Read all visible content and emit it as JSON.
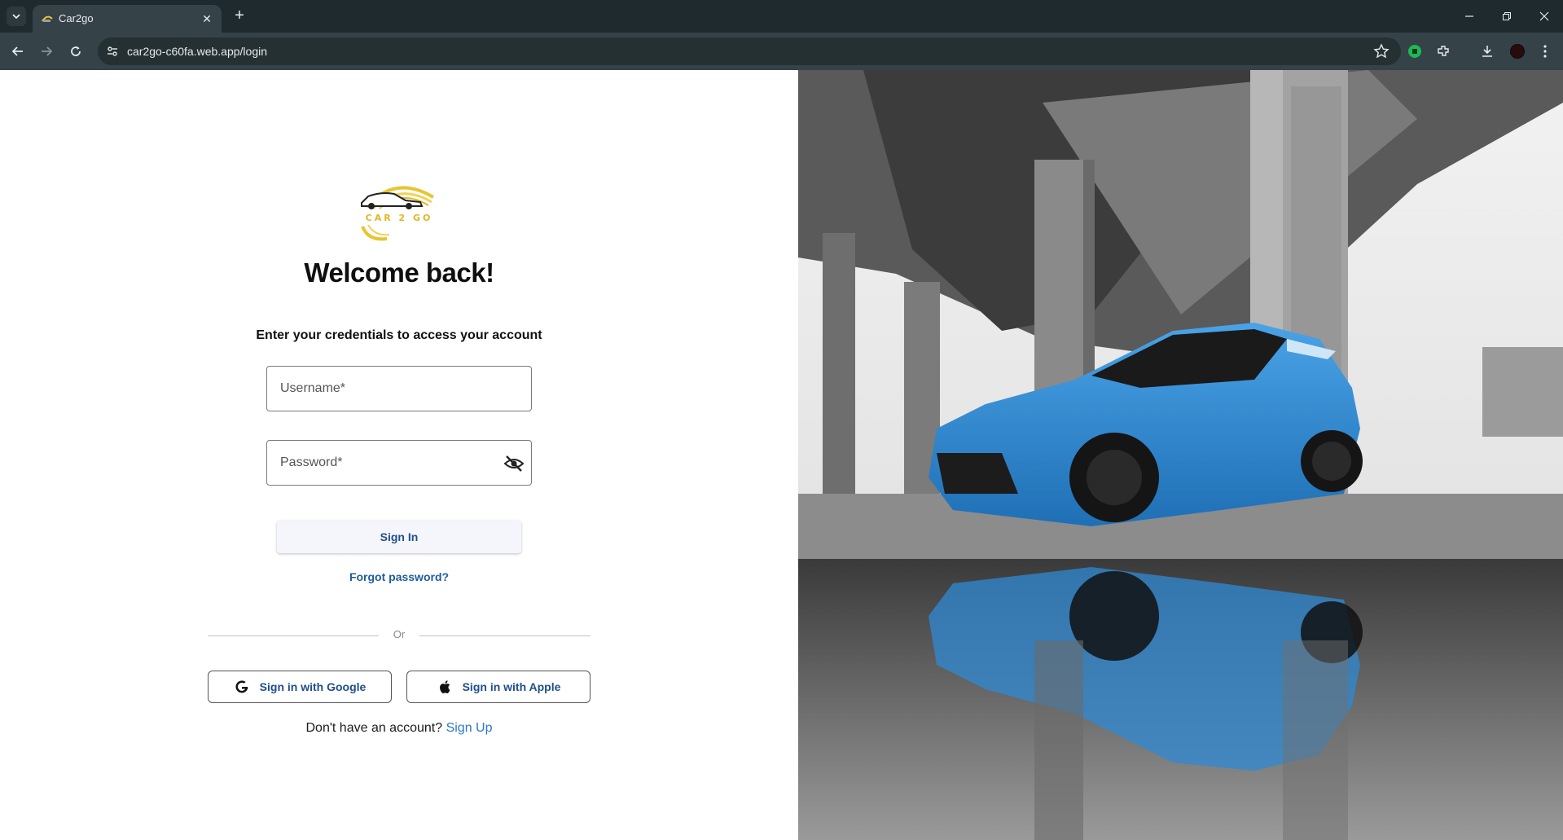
{
  "browser": {
    "tab_title": "Car2go",
    "url": "car2go-c60fa.web.app/login"
  },
  "logo": {
    "text": "CAR 2 GO",
    "accent": "#e8c431"
  },
  "login": {
    "heading": "Welcome back!",
    "subheading": "Enter your credentials to access your account",
    "username_placeholder": "Username*",
    "password_placeholder": "Password*",
    "signin_label": "Sign In",
    "forgot_label": "Forgot password?",
    "or_label": "Or",
    "google_label": "Sign in with Google",
    "apple_label": "Sign in with Apple",
    "signup_prompt": "Don't have an account?",
    "signup_link": "Sign Up"
  },
  "colors": {
    "link": "#2d78c9",
    "button_text": "#1f4f8a",
    "car_blue": "#2f8ad3"
  }
}
